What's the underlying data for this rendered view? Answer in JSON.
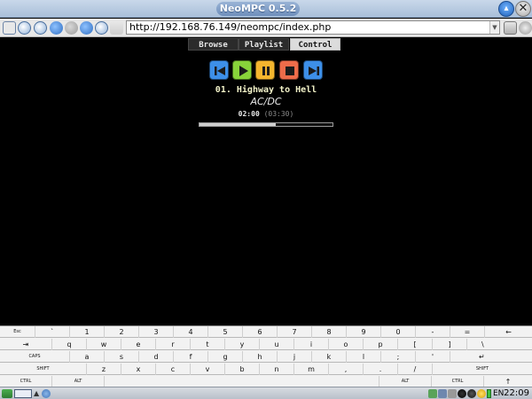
{
  "window": {
    "title": "NeoMPC 0.5.2",
    "minimize_glyph": "▴",
    "close_glyph": "✕"
  },
  "browser": {
    "url": "http://192.168.76.149/neompc/index.php",
    "toolbar_icons": [
      "bookmarks-icon",
      "zoom-in-icon",
      "zoom-out-icon",
      "back-icon",
      "forward-icon",
      "refresh-icon",
      "find-icon",
      "clear-icon"
    ],
    "right_icons": [
      "lock-icon",
      "settings-icon"
    ]
  },
  "nav": {
    "tabs": [
      {
        "label": "Browse",
        "active": false
      },
      {
        "label": "Playlist",
        "active": false
      },
      {
        "label": "Control",
        "active": true
      }
    ]
  },
  "player": {
    "song": "01. Highway to Hell",
    "artist": "AC/DC",
    "time_current": "02:00",
    "time_total": "(03:30)",
    "progress": 0.57,
    "buttons": [
      {
        "name": "previous-button",
        "icon": "previous-icon",
        "color": "#3d8fe8"
      },
      {
        "name": "play-button",
        "icon": "play-icon",
        "color": "#88d33a"
      },
      {
        "name": "pause-button",
        "icon": "pause-icon",
        "color": "#f5b52e"
      },
      {
        "name": "stop-button",
        "icon": "stop-icon",
        "color": "#ee6c4a"
      },
      {
        "name": "next-button",
        "icon": "next-icon",
        "color": "#3d8fe8"
      }
    ]
  },
  "keyboard": {
    "rows": [
      [
        "Esc",
        "`",
        "1",
        "2",
        "3",
        "4",
        "5",
        "6",
        "7",
        "8",
        "9",
        "0",
        "-",
        "=",
        "←"
      ],
      [
        "⇥",
        "q",
        "w",
        "e",
        "r",
        "t",
        "y",
        "u",
        "i",
        "o",
        "p",
        "[",
        "]",
        "\\"
      ],
      [
        "CAPS",
        "a",
        "s",
        "d",
        "f",
        "g",
        "h",
        "j",
        "k",
        "l",
        ";",
        "'",
        "↵"
      ],
      [
        "SHIFT",
        "z",
        "x",
        "c",
        "v",
        "b",
        "n",
        "m",
        ",",
        ".",
        "/",
        "SHIFT"
      ],
      [
        "CTRL",
        "ALT",
        "ALT",
        "CTRL",
        "↑"
      ]
    ]
  },
  "taskbar": {
    "language": "EN",
    "clock": "22:09"
  }
}
